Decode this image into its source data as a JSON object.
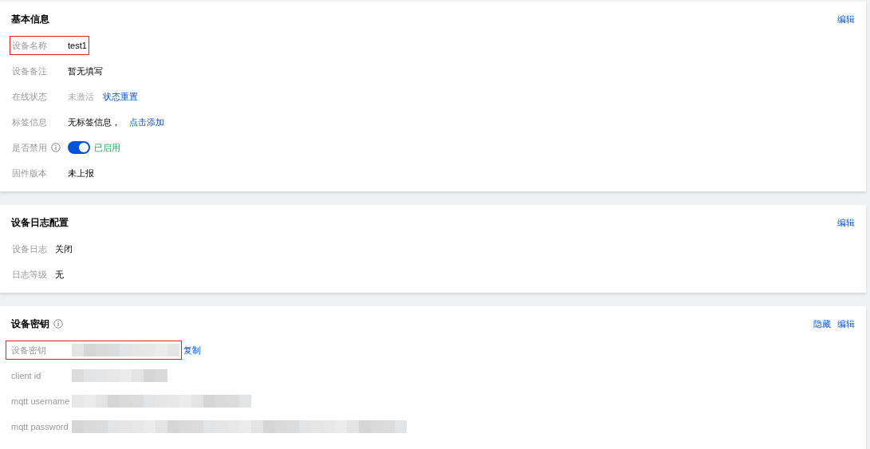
{
  "sections": [
    {
      "title": "基本信息",
      "info_icon": false,
      "actions": [
        "编辑"
      ],
      "rows": [
        {
          "label": "设备名称",
          "highlighted": true,
          "info_icon": false,
          "kind": "text",
          "value": "test1"
        },
        {
          "label": "设备备注",
          "highlighted": false,
          "info_icon": false,
          "kind": "text",
          "value": "暂无填写"
        },
        {
          "label": "在线状态",
          "highlighted": false,
          "info_icon": false,
          "kind": "muted_link",
          "value": "未激活",
          "link": "状态重置"
        },
        {
          "label": "标签信息",
          "highlighted": false,
          "info_icon": false,
          "kind": "text_link",
          "value": "无标签信息，",
          "link": "点击添加"
        },
        {
          "label": "是否禁用",
          "highlighted": false,
          "info_icon": true,
          "kind": "switch",
          "on": true,
          "value": "已启用"
        },
        {
          "label": "固件版本",
          "highlighted": false,
          "info_icon": false,
          "kind": "text",
          "value": "未上报"
        }
      ]
    },
    {
      "title": "设备日志配置",
      "info_icon": false,
      "actions": [
        "编辑"
      ],
      "rows": [
        {
          "label": "设备日志",
          "highlighted": false,
          "info_icon": false,
          "kind": "text",
          "value": "关闭"
        },
        {
          "label": "日志等级",
          "highlighted": false,
          "info_icon": false,
          "kind": "text",
          "value": "无"
        }
      ]
    },
    {
      "title": "设备密钥",
      "info_icon": true,
      "actions": [
        "隐藏",
        "编辑"
      ],
      "rows": [
        {
          "label": "设备密钥",
          "highlighted": true,
          "info_icon": false,
          "kind": "redacted",
          "link": "复制"
        },
        {
          "label": "client id",
          "highlighted": false,
          "info_icon": false,
          "kind": "redacted"
        },
        {
          "label": "mqtt username",
          "highlighted": false,
          "info_icon": false,
          "kind": "redacted"
        },
        {
          "label": "mqtt password",
          "highlighted": false,
          "info_icon": false,
          "kind": "redacted"
        }
      ]
    }
  ]
}
